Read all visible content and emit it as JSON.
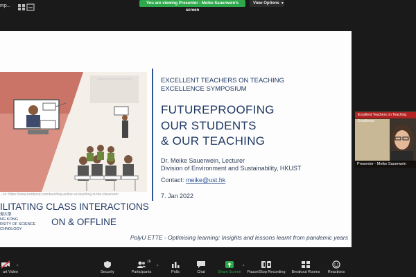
{
  "topbar": {
    "camera_name": "mp...",
    "viewing_label": "You are viewing Presenter - Meike Sauerwein's screen",
    "view_options_label": "View Options"
  },
  "slide": {
    "image_credit": "...ce: https://www.nerdynut.com/teaching-online-vs-teaching-in-the-classroom",
    "facilitating_line1": "ILITATING CLASS INTERACTIONS",
    "facilitating_line2": "ON & OFFLINE",
    "symposium_line1": "EXCELLENT TEACHERS ON TEACHING",
    "symposium_line2": "EXCELLENCE SYMPOSIUM",
    "title_line1": "FUTUREPROOFING",
    "title_line2": "OUR STUDENTS",
    "title_line3": "& OUR TEACHING",
    "speaker_line1": "Dr. Meike Sauerwein, Lecturer",
    "speaker_line2": "Division of Environment and Sustainability, HKUST",
    "contact_label": "Contact:",
    "contact_email": "meike@ust.hk",
    "date": "7. Jan 2022",
    "logo_text": "港大學\nNG KONG\nRSITY OF SCIENCE\nCHNOLOGY",
    "footer": "PolyU ETTE - Optimising learning: Insights and lessons learnt from pandemic years"
  },
  "thumbnail": {
    "banner": "Excellent Teachers on Teaching Excellence",
    "name": "Presenter - Meike Sauerwein"
  },
  "toolbar": {
    "start_video": "art Video",
    "security": "Security",
    "participants": "Participants",
    "participants_count": "16",
    "polls": "Polls",
    "chat": "Chat",
    "share_screen": "Share Screen",
    "record": "Pause/Stop Recording",
    "breakout": "Breakout Rooms",
    "reactions": "Reactions"
  },
  "colors": {
    "accent_green": "#2ea84a",
    "slide_navy": "#1f3864",
    "banner_red": "#b22222"
  }
}
